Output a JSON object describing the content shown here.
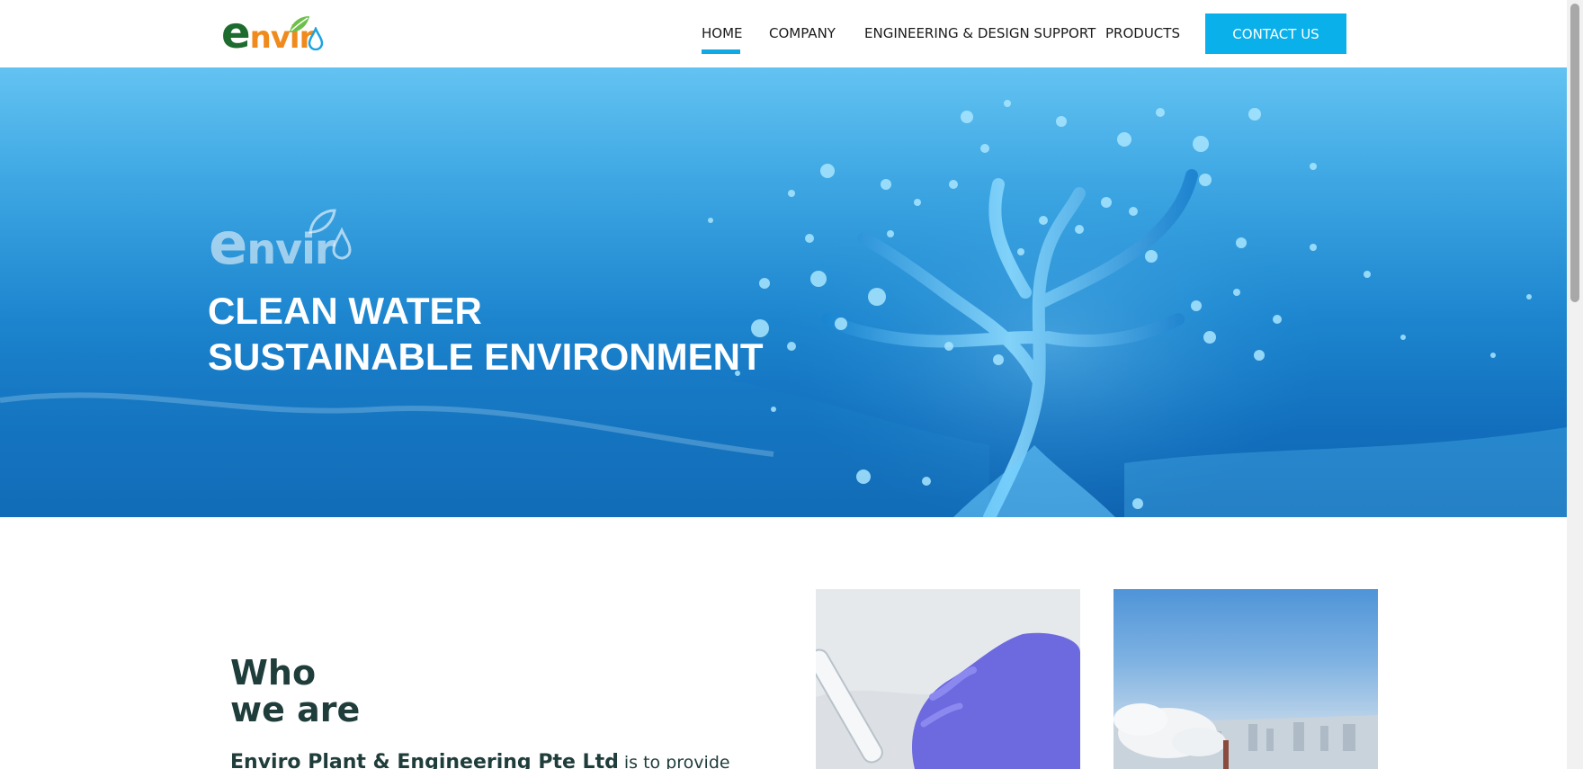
{
  "header": {
    "logo_alt": "Enviro",
    "nav": {
      "home": "HOME",
      "company": "COMPANY",
      "engineering": "ENGINEERING & DESIGN SUPPORT",
      "products": "PRODUCTS",
      "contact": "CONTACT US"
    },
    "active_item": "HOME"
  },
  "hero": {
    "logo_text_e": "e",
    "logo_text_rest": "nvir",
    "title_line1": "CLEAN WATER",
    "title_line2": "SUSTAINABLE ENVIRONMENT"
  },
  "logo": {
    "e": "e",
    "rest": "nvir"
  },
  "who": {
    "title_line1": "Who",
    "title_line2": "we are",
    "company_name": "Enviro Plant & Engineering Pte Ltd",
    "intro_rest": " is to provide"
  },
  "colors": {
    "accent": "#0ab0ea",
    "logo_green": "#1d6b2e",
    "logo_orange": "#f08a1c",
    "heading": "#1f3d3b"
  },
  "images": {
    "hero": "water-splash-tree-image",
    "card1": "lab-test-tube-glove-image",
    "card2": "city-smoke-sky-image"
  }
}
